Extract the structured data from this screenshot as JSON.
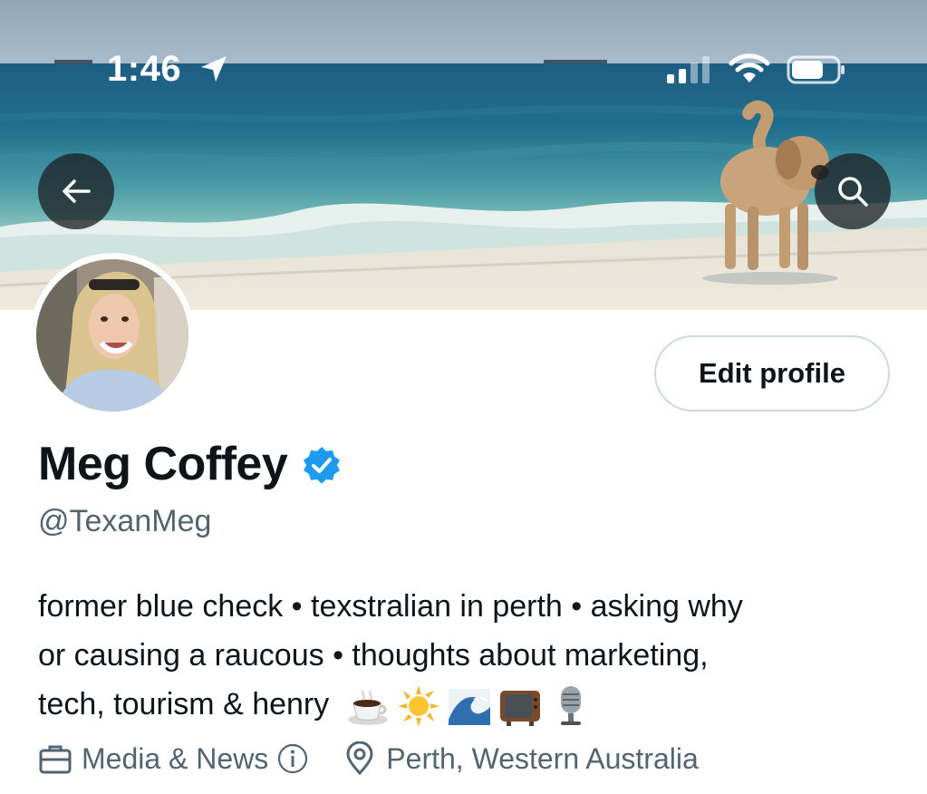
{
  "status_bar": {
    "time": "1:46"
  },
  "header": {
    "back_icon": "arrow-left-icon",
    "search_icon": "search-icon"
  },
  "profile": {
    "display_name": "Meg Coffey",
    "handle": "@TexanMeg",
    "edit_label": "Edit profile",
    "verified_color": "#1d9bf0",
    "bio_lines": [
      "former blue check • texstralian in perth • asking why",
      "or causing a raucous • thoughts about marketing,",
      "tech, tourism & henry"
    ],
    "bio_emojis": [
      "coffee-emoji",
      "sun-emoji",
      "wave-emoji",
      "tv-emoji",
      "microphone-emoji"
    ],
    "category": "Media & News",
    "location": "Perth, Western Australia"
  },
  "colors": {
    "text_primary": "#0f1419",
    "text_secondary": "#536471",
    "border": "#cfd9de"
  }
}
